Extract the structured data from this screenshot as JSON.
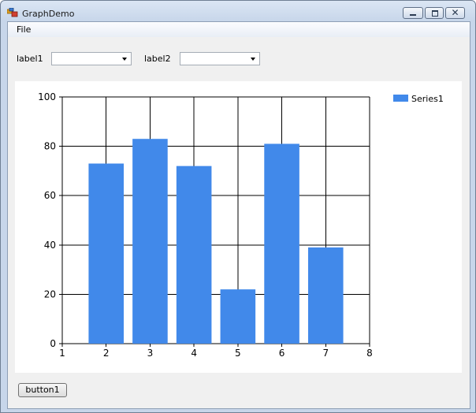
{
  "window": {
    "title": "GraphDemo",
    "close_glyph": "✕"
  },
  "menu": {
    "items": [
      "File"
    ]
  },
  "controls": {
    "label1": "label1",
    "combo1_value": "",
    "label2": "label2",
    "combo2_value": "",
    "button1": "button1"
  },
  "colors": {
    "bar": "#4189ea",
    "grid": "#000000"
  },
  "chart_data": {
    "type": "bar",
    "x": [
      2,
      3,
      4,
      5,
      6,
      7
    ],
    "series": [
      {
        "name": "Series1",
        "values": [
          73,
          83,
          72,
          22,
          81,
          39
        ]
      }
    ],
    "xlim": [
      1,
      8
    ],
    "ylim": [
      0,
      100
    ],
    "x_ticks": [
      1,
      2,
      3,
      4,
      5,
      6,
      7,
      8
    ],
    "y_ticks": [
      0,
      20,
      40,
      60,
      80,
      100
    ],
    "grid": true,
    "legend": "top-right"
  }
}
